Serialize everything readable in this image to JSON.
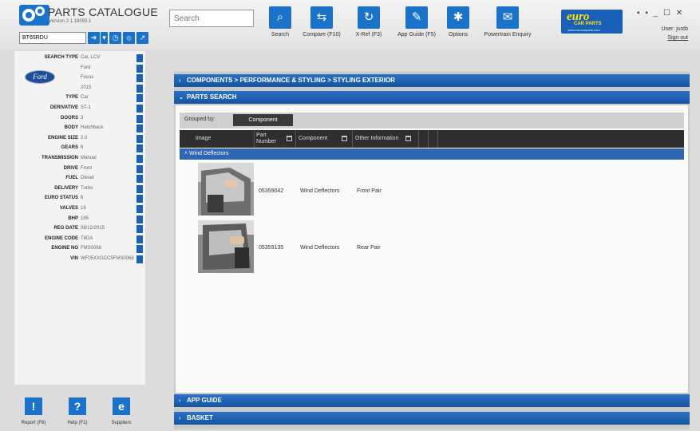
{
  "app": {
    "title": "PARTS CATALOGUE",
    "version": "Version 2.1.18093.1",
    "registration": "BT65RDU"
  },
  "search": {
    "placeholder": "Search"
  },
  "toolbar": [
    {
      "label": "Search",
      "icon": "search-icon",
      "glyph": "⌕"
    },
    {
      "label": "Compare (F10)",
      "icon": "compare-icon",
      "glyph": "⇆"
    },
    {
      "label": "X-Ref (F3)",
      "icon": "xref-icon",
      "glyph": "↻"
    },
    {
      "label": "App Guide (F5)",
      "icon": "wrench-icon",
      "glyph": "✎"
    },
    {
      "label": "Options",
      "icon": "gear-icon",
      "glyph": "✱"
    },
    {
      "label": "Powertrain Enquiry",
      "icon": "mail-icon",
      "glyph": "✉"
    }
  ],
  "brand": {
    "name": "euro",
    "sub": "CAR PARTS",
    "url": "www.eurocarparts.com"
  },
  "user": {
    "label": "User: justb",
    "signout": "Sign out"
  },
  "vehicle": [
    {
      "key": "SEARCH TYPE",
      "value": "Car, LCV"
    },
    {
      "key": "",
      "value": "Ford"
    },
    {
      "key": "",
      "value": "Focus"
    },
    {
      "key": "",
      "value": "2015"
    },
    {
      "key": "TYPE",
      "value": "Car"
    },
    {
      "key": "DERIVATIVE",
      "value": "ST-1"
    },
    {
      "key": "DOORS",
      "value": "3"
    },
    {
      "key": "BODY",
      "value": "Hatchback"
    },
    {
      "key": "ENGINE SIZE",
      "value": "2.0"
    },
    {
      "key": "GEARS",
      "value": "6"
    },
    {
      "key": "TRANSMISSION",
      "value": "Manual"
    },
    {
      "key": "DRIVE",
      "value": "Front"
    },
    {
      "key": "FUEL",
      "value": "Diesel"
    },
    {
      "key": "DELIVERY",
      "value": "Turbo"
    },
    {
      "key": "EURO STATUS",
      "value": "6"
    },
    {
      "key": "VALVES",
      "value": "16"
    },
    {
      "key": "BHP",
      "value": "185"
    },
    {
      "key": "REG DATE",
      "value": "08/12/2015"
    },
    {
      "key": "ENGINE CODE",
      "value": "T8DA"
    },
    {
      "key": "ENGINE NO",
      "value": "FMS0068"
    },
    {
      "key": "VIN",
      "value": "WF05XXGCC5FMS0068"
    }
  ],
  "make_logo": "Ford",
  "bottom_buttons": [
    {
      "label": "Report (F6)",
      "glyph": "!",
      "icon": "report-icon"
    },
    {
      "label": "Help (F1)",
      "glyph": "?",
      "icon": "help-icon"
    },
    {
      "label": "Suppliers",
      "glyph": "e",
      "icon": "suppliers-icon"
    }
  ],
  "breadcrumb": "COMPONENTS > PERFORMANCE & STYLING > STYLING EXTERIOR",
  "parts_search": {
    "title": "PARTS SEARCH",
    "grouped_by_label": "Grouped by:",
    "grouped_by_value": "Component",
    "columns": [
      "Image",
      "Part Number",
      "Component",
      "Other Information"
    ],
    "group": "Wind Deflectors",
    "rows": [
      {
        "part_number": "05359042",
        "component": "Wind Deflectors",
        "info": "Front Pair"
      },
      {
        "part_number": "05359135",
        "component": "Wind Deflectors",
        "info": "Rear Pair"
      }
    ]
  },
  "sections": {
    "app_guide": "APP GUIDE",
    "basket": "BASKET"
  },
  "window_controls": "▪ ▪ _ ☐ ✕"
}
